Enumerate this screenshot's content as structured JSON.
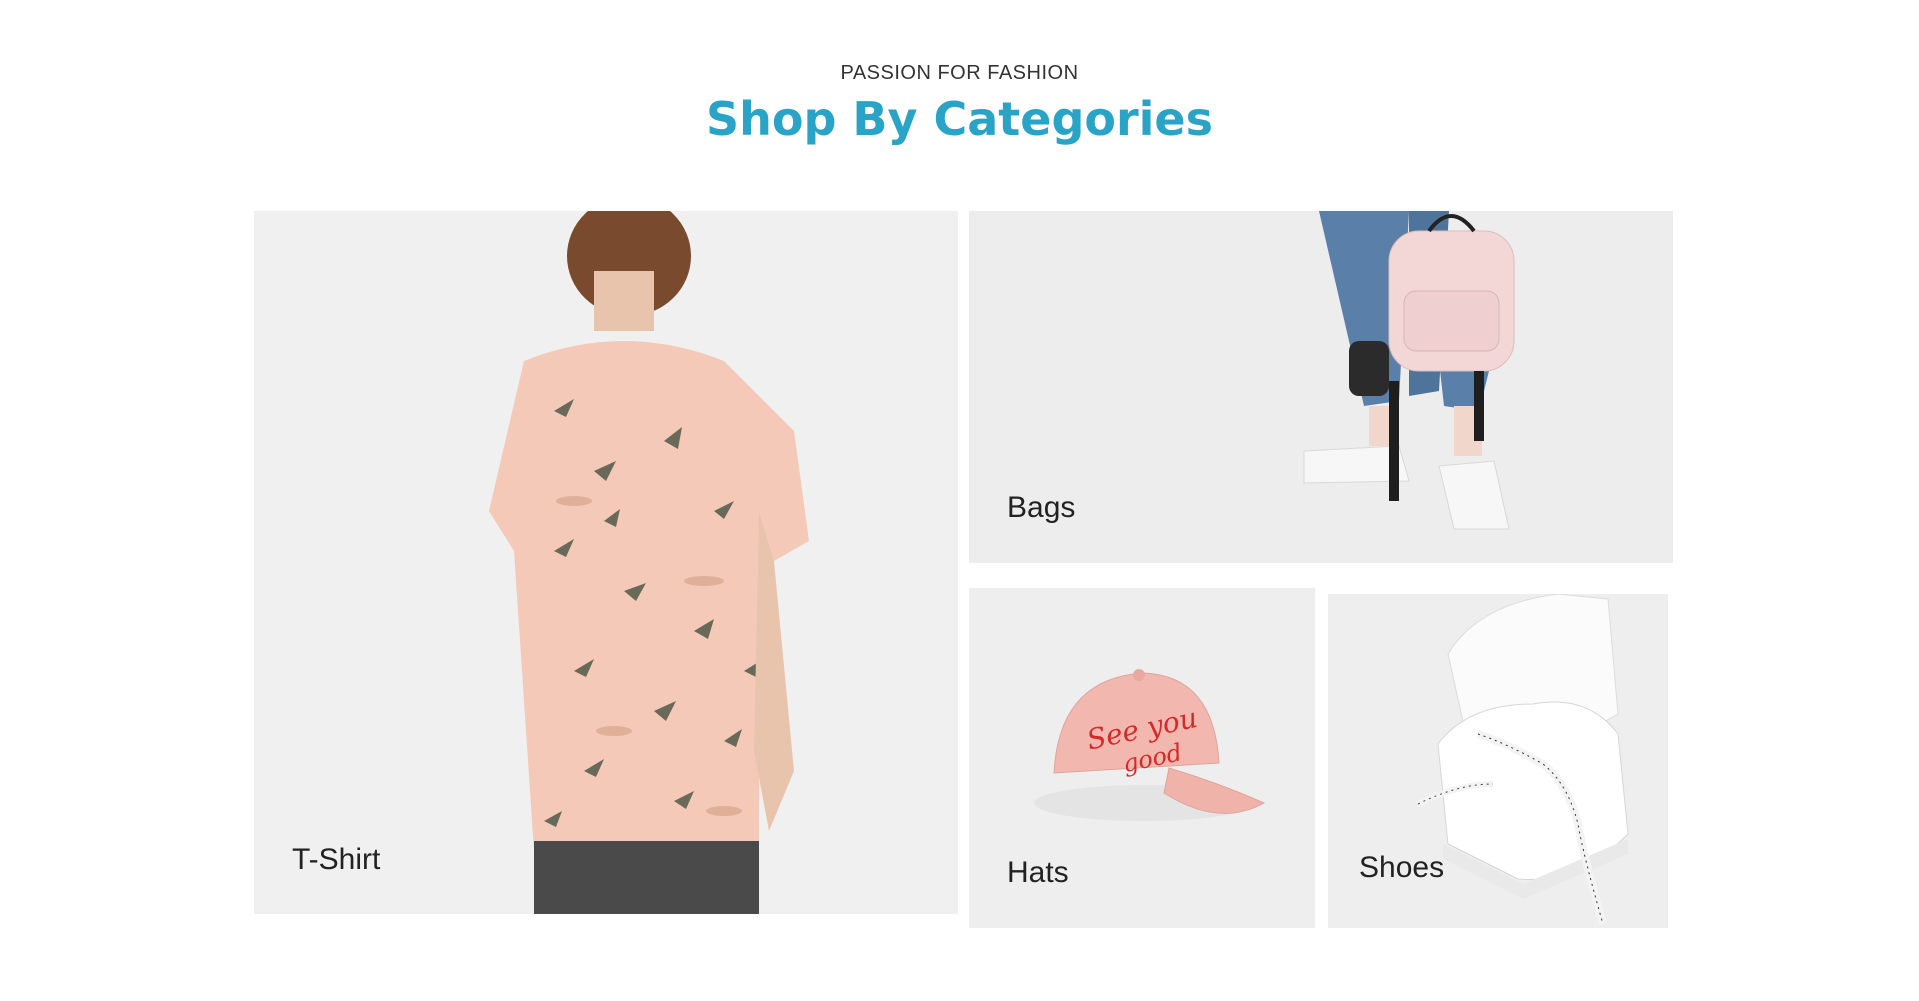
{
  "section": {
    "eyebrow": "PASSION FOR FASHION",
    "title": "Shop By Categories"
  },
  "categories": [
    {
      "label": "T-Shirt",
      "image": "floral-shirt-photo"
    },
    {
      "label": "Bags",
      "image": "backpack-photo"
    },
    {
      "label": "Hats",
      "image": "pink-cap-photo"
    },
    {
      "label": "Shoes",
      "image": "white-sneakers-photo"
    }
  ],
  "colors": {
    "accent": "#2aa4c6",
    "card_bg": "#efefef",
    "label": "#222222"
  }
}
